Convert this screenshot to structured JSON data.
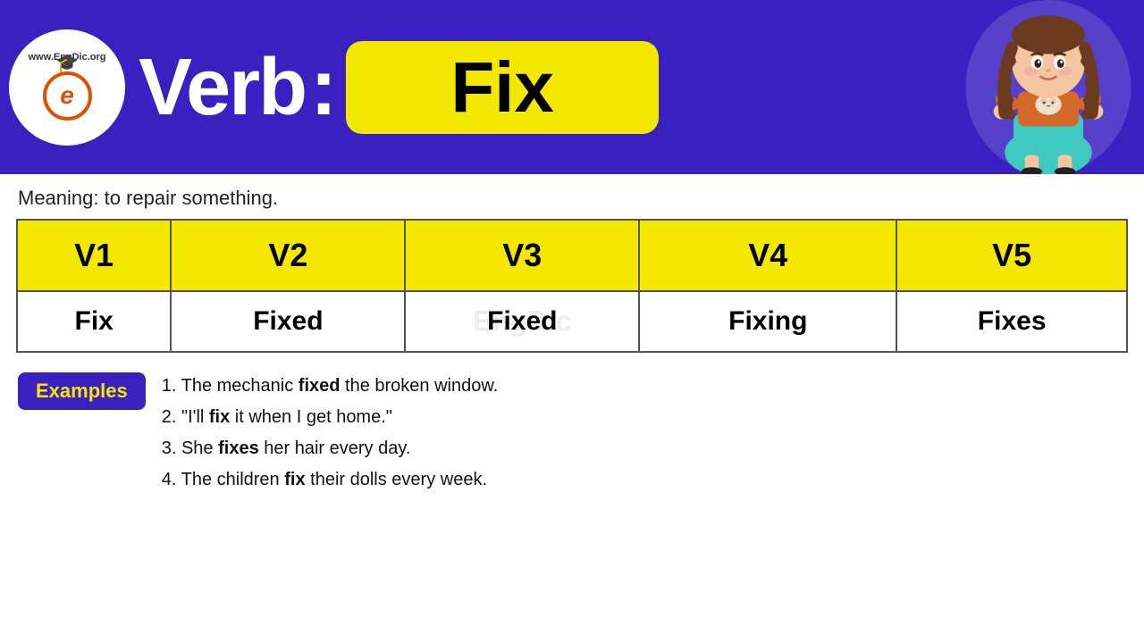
{
  "header": {
    "logo": {
      "site_text": "www.EngDic.org",
      "letter": "e"
    },
    "title": "Verb",
    "colon": ":",
    "verb": "Fix"
  },
  "meaning": {
    "label": "Meaning:",
    "text": "to repair something."
  },
  "table": {
    "headers": [
      "V1",
      "V2",
      "V3",
      "V4",
      "V5"
    ],
    "values": [
      "Fix",
      "Fixed",
      "Fixed",
      "Fixing",
      "Fixes"
    ]
  },
  "examples": {
    "badge": "Examples",
    "items": [
      {
        "number": "1.",
        "pre": "The mechanic ",
        "bold": "fixed",
        "post": " the broken window."
      },
      {
        "number": "2.",
        "pre": "\"I'll ",
        "bold": "fix",
        "post": " it when I get home.\""
      },
      {
        "number": "3.",
        "pre": "She ",
        "bold": "fixes",
        "post": " her hair every day."
      },
      {
        "number": "4.",
        "pre": "The children ",
        "bold": "fix",
        "post": " their dolls every week."
      }
    ]
  }
}
